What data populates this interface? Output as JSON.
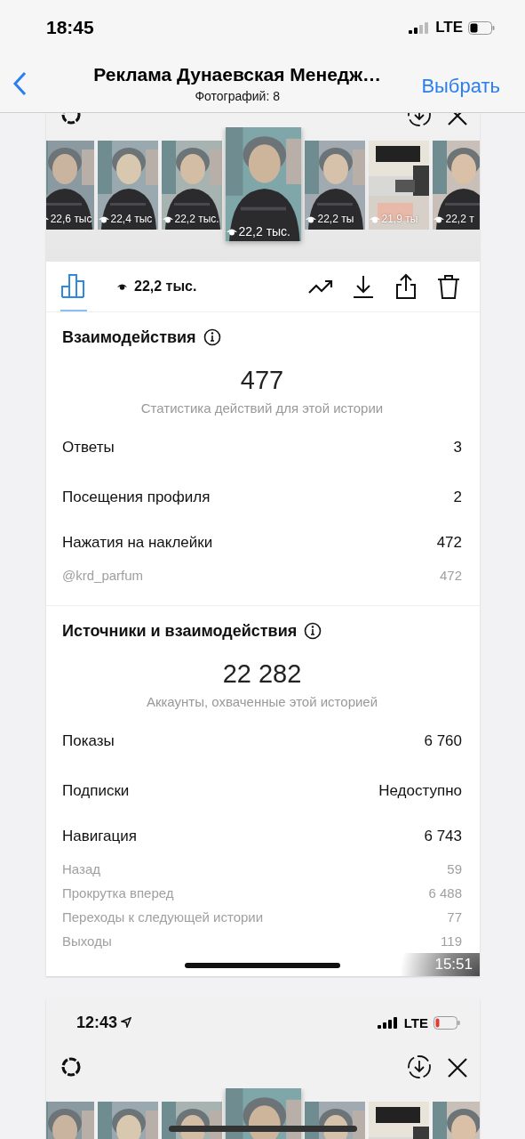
{
  "status_bar": {
    "time": "18:45",
    "network": "LTE"
  },
  "nav": {
    "title": "Реклама Дунаевская Менедж…",
    "subtitle": "Фотографий: 8",
    "action": "Выбрать"
  },
  "stats_screenshot": {
    "thumbnails": [
      {
        "views": "22,6 тыс",
        "selected": false
      },
      {
        "views": "22,4 тыс",
        "selected": false
      },
      {
        "views": "22,2 тыс.",
        "selected": false
      },
      {
        "views": "22,2 тыс.",
        "selected": true
      },
      {
        "views": "22,2 ты",
        "selected": false
      },
      {
        "views": "21,9 ты",
        "selected": false
      },
      {
        "views": "22,2 т",
        "selected": false
      }
    ],
    "toolbar_views": "22,2 тыс.",
    "sections": [
      {
        "title": "Взаимодействия",
        "total": "477",
        "caption": "Статистика действий для этой истории",
        "rows": [
          {
            "kind": "main",
            "label": "Ответы",
            "value": "3"
          },
          {
            "kind": "main",
            "label": "Посещения профиля",
            "value": "2"
          },
          {
            "kind": "head",
            "label": "Нажатия на наклейки",
            "value": "472"
          },
          {
            "kind": "sub",
            "label": "@krd_parfum",
            "value": "472"
          }
        ]
      },
      {
        "title": "Источники и взаимодействия",
        "total": "22 282",
        "caption": "Аккаунты, охваченные этой историей",
        "rows": [
          {
            "kind": "main",
            "label": "Показы",
            "value": "6 760"
          },
          {
            "kind": "main",
            "label": "Подписки",
            "value": "Недоступно"
          },
          {
            "kind": "head",
            "label": "Навигация",
            "value": "6 743"
          },
          {
            "kind": "sub",
            "label": "Назад",
            "value": "59"
          },
          {
            "kind": "sub",
            "label": "Прокрутка вперед",
            "value": "6 488"
          },
          {
            "kind": "sub",
            "label": "Переходы к следующей истории",
            "value": "77"
          },
          {
            "kind": "sub",
            "label": "Выходы",
            "value": "119"
          }
        ]
      }
    ],
    "duration": "15:51"
  },
  "next_screenshot": {
    "time": "12:43",
    "network": "LTE"
  }
}
